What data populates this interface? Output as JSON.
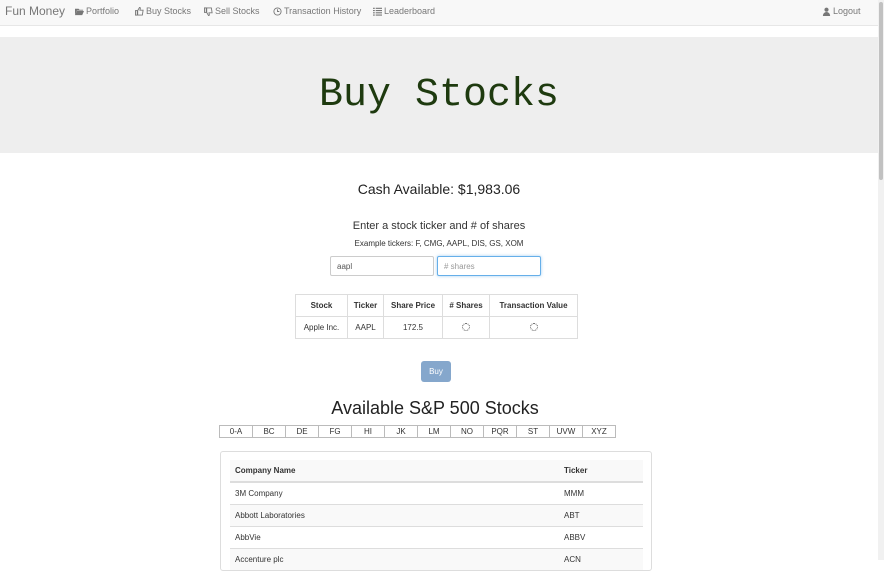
{
  "nav": {
    "brand": "Fun Money",
    "links": [
      {
        "label": "Portfolio",
        "icon": "folder-open-icon"
      },
      {
        "label": "Buy Stocks",
        "icon": "thumbs-up-icon"
      },
      {
        "label": "Sell Stocks",
        "icon": "thumbs-down-icon"
      },
      {
        "label": "Transaction History",
        "icon": "clock-icon"
      },
      {
        "label": "Leaderboard",
        "icon": "list-icon"
      }
    ],
    "logout": {
      "label": "Logout",
      "icon": "user-icon"
    }
  },
  "jumbotron": {
    "title": "Buy Stocks"
  },
  "cash": {
    "label": "Cash Available: $1,983.06"
  },
  "form": {
    "instruction": "Enter a stock ticker and # of shares",
    "examples": "Example tickers: F, CMG, AAPL, DIS, GS, XOM",
    "ticker_value": "aapl",
    "shares_placeholder": "# shares"
  },
  "quote_table": {
    "headers": [
      "Stock",
      "Ticker",
      "Share Price",
      "# Shares",
      "Transaction Value"
    ],
    "row": {
      "stock": "Apple Inc.",
      "ticker": "AAPL",
      "price": "172.5"
    }
  },
  "buy_button": "Buy",
  "sp500": {
    "title": "Available S&P 500 Stocks",
    "tabs": [
      "0-A",
      "BC",
      "DE",
      "FG",
      "HI",
      "JK",
      "LM",
      "NO",
      "PQR",
      "ST",
      "UVW",
      "XYZ"
    ],
    "headers": {
      "company": "Company Name",
      "ticker": "Ticker"
    },
    "rows": [
      {
        "company": "3M Company",
        "ticker": "MMM"
      },
      {
        "company": "Abbott Laboratories",
        "ticker": "ABT"
      },
      {
        "company": "AbbVie",
        "ticker": "ABBV"
      },
      {
        "company": "Accenture plc",
        "ticker": "ACN"
      }
    ]
  }
}
